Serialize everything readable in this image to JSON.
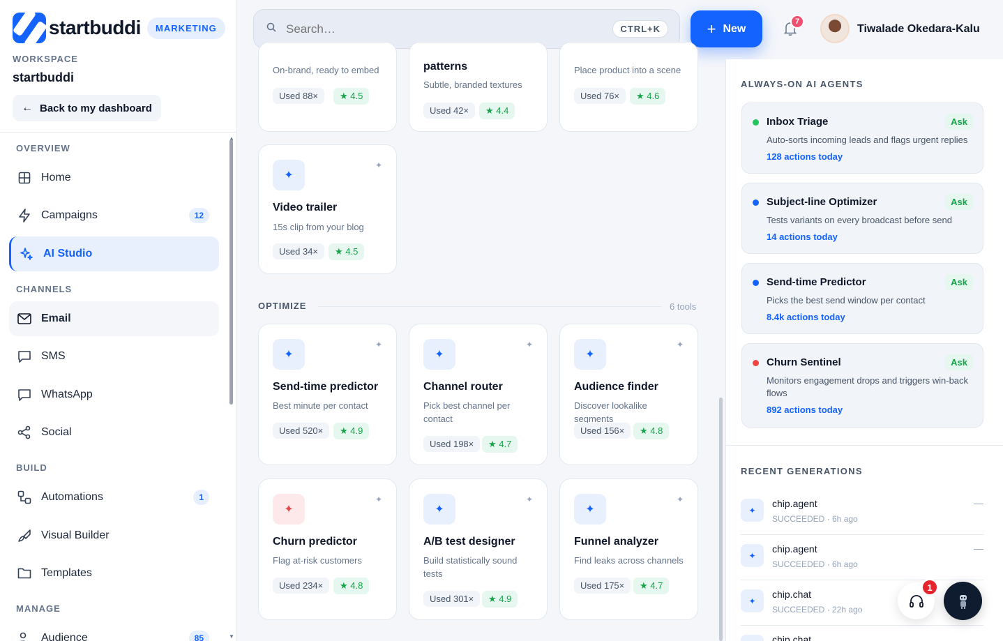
{
  "brand": {
    "name": "startbuddi",
    "badge": "MARKETING"
  },
  "workspace": {
    "label": "WORKSPACE",
    "name": "startbuddi",
    "back_label": "Back to my dashboard"
  },
  "nav": {
    "overview": "OVERVIEW",
    "channels": "CHANNELS",
    "build": "BUILD",
    "manage": "MANAGE",
    "home": "Home",
    "campaigns": "Campaigns",
    "campaigns_badge": "12",
    "ai_studio": "AI Studio",
    "email": "Email",
    "sms": "SMS",
    "whatsapp": "WhatsApp",
    "social": "Social",
    "automations": "Automations",
    "automations_badge": "1",
    "visual_builder": "Visual Builder",
    "templates": "Templates",
    "audience": "Audience",
    "audience_badge": "85"
  },
  "topbar": {
    "search_placeholder": "Search…",
    "search_shortcut": "CTRL+K",
    "new_label": "New",
    "notif_count": "7",
    "user_name": "Tiwalade Okedara-Kalu"
  },
  "tools_top": [
    {
      "desc": "On-brand, ready to embed",
      "used": "Used 88×",
      "rating": "★ 4.5"
    },
    {
      "title": "patterns",
      "desc": "Subtle, branded textures",
      "used": "Used 42×",
      "rating": "★ 4.4"
    },
    {
      "desc": "Place product into a scene",
      "used": "Used 76×",
      "rating": "★ 4.6"
    },
    {
      "title": "Video trailer",
      "desc": "15s clip from your blog",
      "used": "Used 34×",
      "rating": "★ 4.5"
    }
  ],
  "optimize": {
    "label": "OPTIMIZE",
    "count": "6 tools",
    "tools": [
      {
        "title": "Send-time predictor",
        "desc": "Best minute per contact",
        "used": "Used 520×",
        "rating": "★ 4.9"
      },
      {
        "title": "Channel router",
        "desc": "Pick best channel per contact",
        "used": "Used 198×",
        "rating": "★ 4.7"
      },
      {
        "title": "Audience finder",
        "desc": "Discover lookalike segments",
        "used": "Used 156×",
        "rating": "★ 4.8"
      },
      {
        "title": "Churn predictor",
        "desc": "Flag at-risk customers",
        "used": "Used 234×",
        "rating": "★ 4.8"
      },
      {
        "title": "A/B test designer",
        "desc": "Build statistically sound tests",
        "used": "Used 301×",
        "rating": "★ 4.9"
      },
      {
        "title": "Funnel analyzer",
        "desc": "Find leaks across channels",
        "used": "Used 175×",
        "rating": "★ 4.7"
      }
    ]
  },
  "agents": {
    "title": "ALWAYS-ON AI AGENTS",
    "ask_label": "Ask",
    "items": [
      {
        "name": "Inbox Triage",
        "desc": "Auto-sorts incoming leads and flags urgent replies",
        "actions": "128 actions today",
        "color": "#22c55e"
      },
      {
        "name": "Subject-line Optimizer",
        "desc": "Tests variants on every broadcast before send",
        "actions": "14 actions today",
        "color": "#1463ff"
      },
      {
        "name": "Send-time Predictor",
        "desc": "Picks the best send window per contact",
        "actions": "8.4k actions today",
        "color": "#1463ff"
      },
      {
        "name": "Churn Sentinel",
        "desc": "Monitors engagement drops and triggers win-back flows",
        "actions": "892 actions today",
        "color": "#ef4444"
      }
    ]
  },
  "generations": {
    "title": "RECENT GENERATIONS",
    "items": [
      {
        "name": "chip.agent",
        "meta": "SUCCEEDED · 6h ago"
      },
      {
        "name": "chip.agent",
        "meta": "SUCCEEDED · 6h ago"
      },
      {
        "name": "chip.chat",
        "meta": "SUCCEEDED · 22h ago"
      },
      {
        "name": "chip.chat",
        "meta": ""
      }
    ]
  },
  "support": {
    "badge": "1"
  },
  "colors": {
    "accent": "#1463ff",
    "success": "#16a34a",
    "danger": "#e5242e"
  }
}
